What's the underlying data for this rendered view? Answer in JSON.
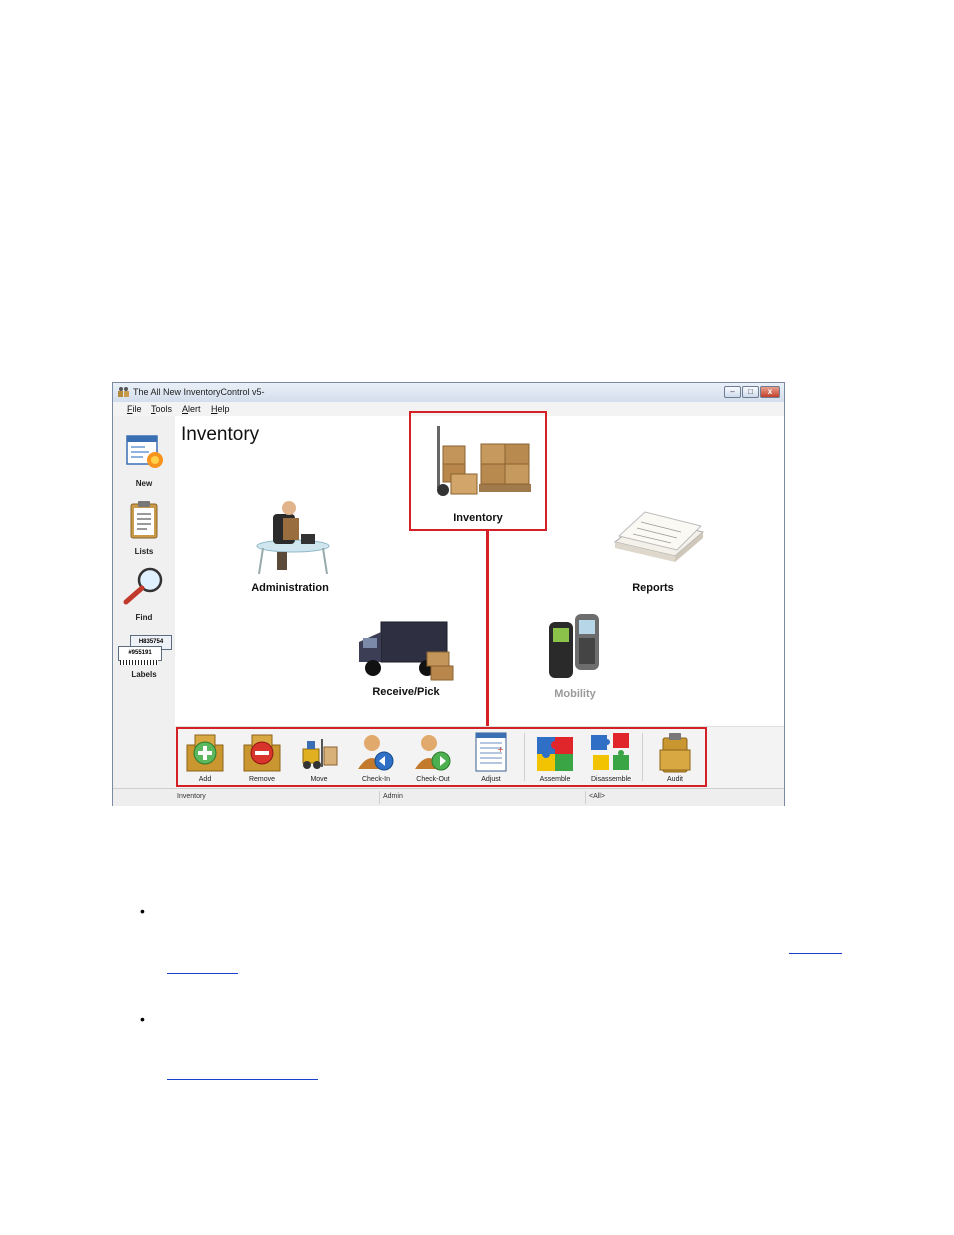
{
  "window": {
    "title": "The All New InventoryControl v5-",
    "minimize_glyph": "–",
    "maximize_glyph": "□",
    "close_glyph": "x"
  },
  "menu": [
    {
      "label": "File",
      "key": "F",
      "rest": "ile"
    },
    {
      "label": "Tools",
      "key": "T",
      "rest": "ools"
    },
    {
      "label": "Alert",
      "key": "A",
      "rest": "lert"
    },
    {
      "label": "Help",
      "key": "H",
      "rest": "elp"
    }
  ],
  "sidebar": {
    "items": [
      {
        "label": "New",
        "icon": "new-document-icon"
      },
      {
        "label": "Lists",
        "icon": "clipboard-icon"
      },
      {
        "label": "Find",
        "icon": "magnifier-icon"
      },
      {
        "label": "Labels",
        "icon": "barcode-labels-icon"
      }
    ],
    "labels_icon_text": [
      "H835754",
      "#955191"
    ]
  },
  "main": {
    "title": "Inventory",
    "modules": [
      {
        "label": "Inventory",
        "icon": "boxes-hand-truck-icon",
        "highlighted": true
      },
      {
        "label": "Administration",
        "icon": "office-desk-icon"
      },
      {
        "label": "Reports",
        "icon": "paper-stack-icon"
      },
      {
        "label": "Receive/Pick",
        "icon": "delivery-truck-icon"
      },
      {
        "label": "Mobility",
        "icon": "handheld-scanner-icon",
        "disabled": true
      }
    ]
  },
  "toolbar": {
    "items": [
      {
        "label": "Add",
        "icon": "add-box-icon"
      },
      {
        "label": "Remove",
        "icon": "remove-box-icon"
      },
      {
        "label": "Move",
        "icon": "forklift-icon"
      },
      {
        "label": "Check-In",
        "icon": "check-in-user-icon"
      },
      {
        "label": "Check-Out",
        "icon": "check-out-user-icon"
      },
      {
        "label": "Adjust",
        "icon": "adjust-sheet-icon"
      },
      {
        "label": "Assemble",
        "icon": "puzzle-assemble-icon"
      },
      {
        "label": "Disassemble",
        "icon": "puzzle-disassemble-icon"
      },
      {
        "label": "Audit",
        "icon": "audit-clipboard-icon"
      }
    ]
  },
  "statusbar": {
    "module": "Inventory",
    "user": "Admin",
    "filter": "<All>"
  },
  "colors": {
    "highlight": "#d32026",
    "link": "#1a3fd1"
  }
}
